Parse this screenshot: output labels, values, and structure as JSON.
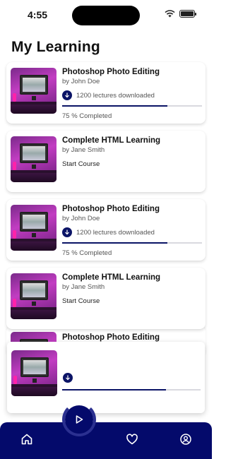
{
  "status_bar": {
    "time": "4:55"
  },
  "page": {
    "title": "My Learning"
  },
  "courses": [
    {
      "title": "Photoshop Photo Editing",
      "author": "by John Doe",
      "download_text": "1200 lectures downloaded",
      "progress": 0.75,
      "progress_label": "75 % Completed"
    },
    {
      "title": "Complete HTML Learning",
      "author": "by Jane Smith",
      "action_label": "Start Course"
    },
    {
      "title": "Photoshop Photo Editing",
      "author": "by John Doe",
      "download_text": "1200 lectures downloaded",
      "progress": 0.75,
      "progress_label": "75 % Completed"
    },
    {
      "title": "Complete HTML Learning",
      "author": "by Jane Smith",
      "action_label": "Start Course"
    },
    {
      "title": "Photoshop Photo Editing"
    }
  ],
  "mini_player": {
    "progress": 0.75
  },
  "tab_bar": {
    "items": [
      "home-icon",
      "heart-icon",
      "profile-icon"
    ]
  },
  "colors": {
    "accent": "#0b1466",
    "tab_bar": "#040a6b",
    "thumbnail": "#c23dc2"
  }
}
